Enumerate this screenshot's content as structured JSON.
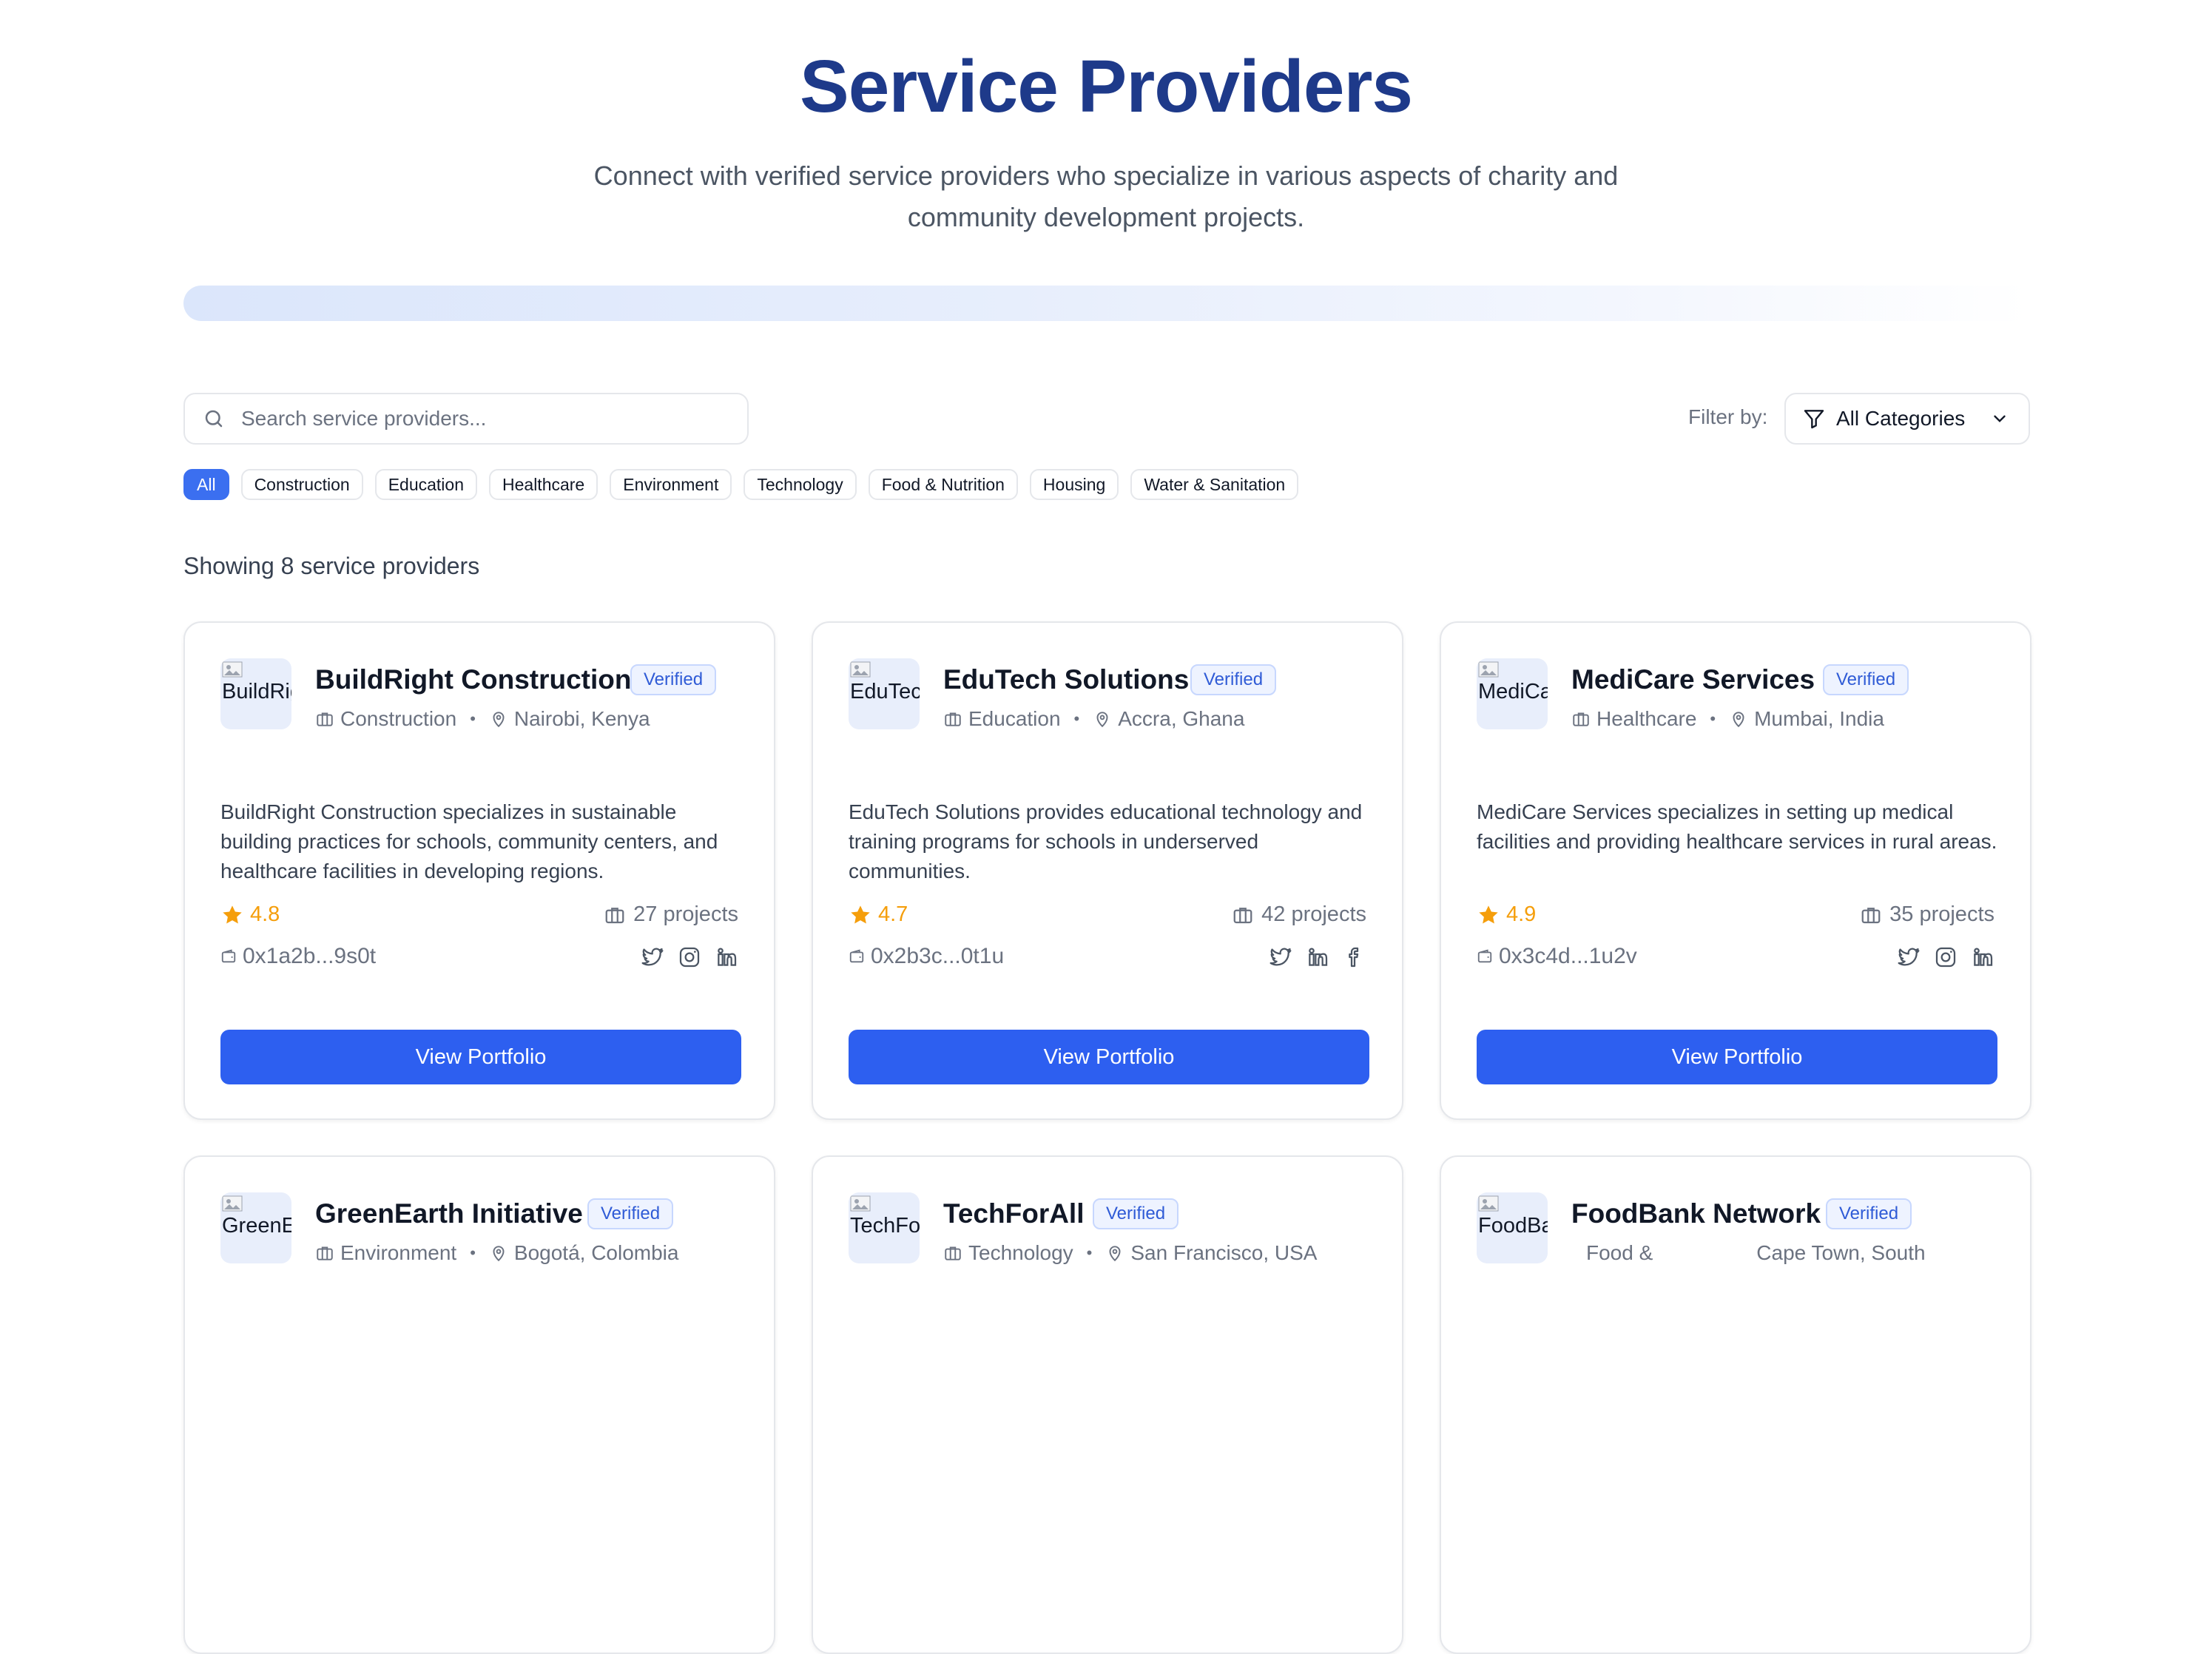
{
  "header": {
    "title": "Service Providers",
    "subtitle": "Connect with verified service providers who specialize in various aspects of charity and community development projects."
  },
  "search": {
    "placeholder": "Search service providers...",
    "value": ""
  },
  "filter": {
    "label": "Filter by:",
    "selected": "All Categories"
  },
  "chips": [
    "All",
    "Construction",
    "Education",
    "Healthcare",
    "Environment",
    "Technology",
    "Food & Nutrition",
    "Housing",
    "Water & Sanitation"
  ],
  "active_chip": "All",
  "result_count": "Showing 8 service providers",
  "colors": {
    "primary": "#2d5ff0",
    "title": "#1e3a8a",
    "star": "#f59e0b",
    "verified_text": "#2f5bd6"
  },
  "icons": [
    "search-icon",
    "filter-icon",
    "chevron-down-icon",
    "briefcase-icon",
    "map-pin-icon",
    "star-icon",
    "wallet-icon",
    "twitter-icon",
    "instagram-icon",
    "linkedin-icon",
    "facebook-icon",
    "broken-image-icon"
  ],
  "providers": [
    {
      "logo_alt": "BuildRight Construction",
      "name": "BuildRight Construction",
      "verified": "Verified",
      "category": "Construction",
      "location": "Nairobi, Kenya",
      "description": "BuildRight Construction specializes in sustainable building practices for schools, community centers, and healthcare facilities in developing regions.",
      "rating": "4.8",
      "projects": "27 projects",
      "wallet": "0x1a2b...9s0t",
      "socials": [
        "twitter",
        "instagram",
        "linkedin"
      ],
      "button": "View Portfolio"
    },
    {
      "logo_alt": "EduTech Solutions",
      "name": "EduTech Solutions",
      "verified": "Verified",
      "category": "Education",
      "location": "Accra, Ghana",
      "description": "EduTech Solutions provides educational technology and training programs for schools in underserved communities.",
      "rating": "4.7",
      "projects": "42 projects",
      "wallet": "0x2b3c...0t1u",
      "socials": [
        "twitter",
        "linkedin",
        "facebook"
      ],
      "button": "View Portfolio"
    },
    {
      "logo_alt": "MediCare Services",
      "name": "MediCare Services",
      "verified": "Verified",
      "category": "Healthcare",
      "location": "Mumbai, India",
      "description": "MediCare Services specializes in setting up medical facilities and providing healthcare services in rural areas.",
      "rating": "4.9",
      "projects": "35 projects",
      "wallet": "0x3c4d...1u2v",
      "socials": [
        "twitter",
        "instagram",
        "linkedin"
      ],
      "button": "View Portfolio"
    },
    {
      "logo_alt": "GreenEarth Initiative",
      "name": "GreenEarth Initiative",
      "verified": "Verified",
      "category": "Environment",
      "location": "Bogotá, Colombia"
    },
    {
      "logo_alt": "TechForAll",
      "name": "TechForAll",
      "verified": "Verified",
      "category": "Technology",
      "location": "San Francisco, USA"
    },
    {
      "logo_alt": "FoodBank Network",
      "name": "FoodBank Network",
      "verified": "Verified",
      "category": "Food &",
      "location": "Cape Town, South"
    }
  ]
}
